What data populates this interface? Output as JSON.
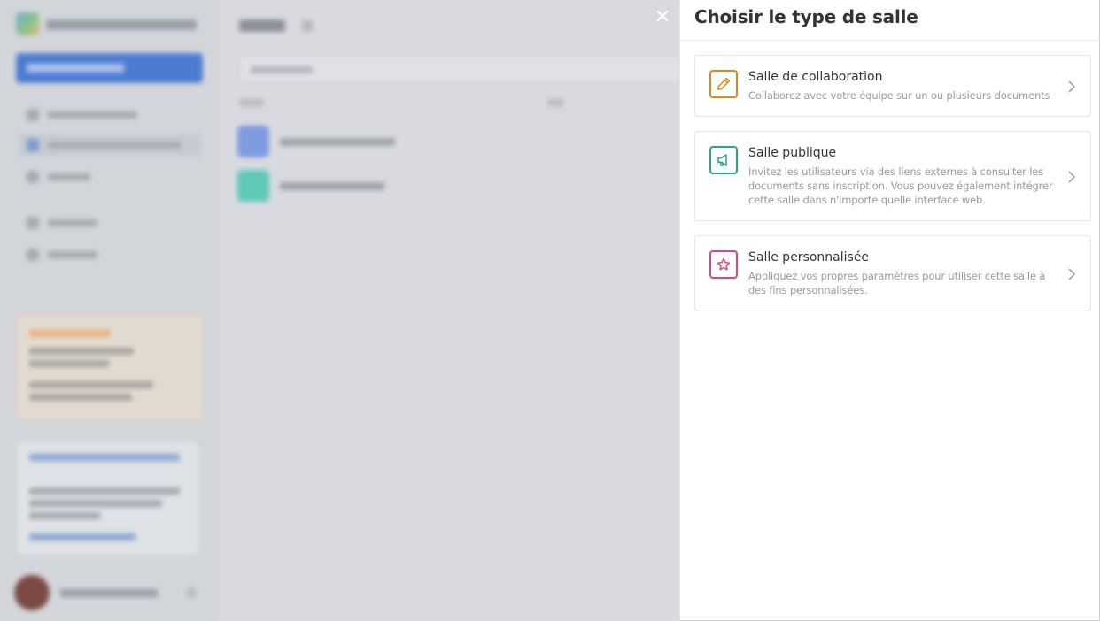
{
  "panel": {
    "title": "Choisir le type de salle",
    "close_icon": "close-icon"
  },
  "room_types": [
    {
      "id": "collaboration",
      "title": "Salle de collaboration",
      "description": "Collaborez avec votre équipe sur un ou plusieurs documents",
      "icon": "pencil-icon",
      "color": "#E8850F"
    },
    {
      "id": "public",
      "title": "Salle publique",
      "description": "Invitez les utilisateurs via des liens externes à consulter les documents sans inscription. Vous pouvez également intégrer cette salle dans n'importe quelle interface web.",
      "icon": "megaphone-icon",
      "color": "#22AA88"
    },
    {
      "id": "custom",
      "title": "Salle personnalisée",
      "description": "Appliquez vos propres paramètres pour utiliser cette salle à des fins personnalisées.",
      "icon": "star-icon",
      "color": "#E0457B"
    }
  ],
  "colors": {
    "overlay": "#D7D9DD",
    "panel_bg": "#FFFFFF",
    "title_text": "#333333",
    "desc_text": "#999999",
    "card_border": "#E4E6EA",
    "chevron": "#A3A9AE"
  }
}
